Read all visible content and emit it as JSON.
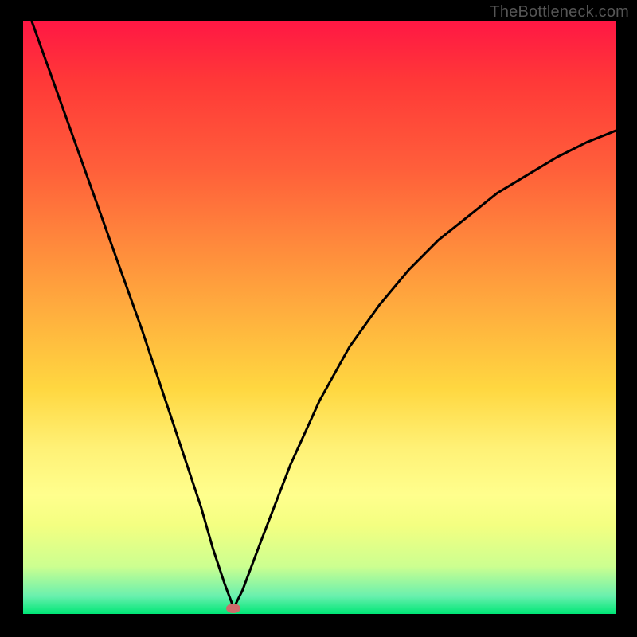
{
  "watermark": "TheBottleneck.com",
  "chart_data": {
    "type": "line",
    "title": "",
    "xlabel": "",
    "ylabel": "",
    "xlim": [
      0,
      100
    ],
    "ylim": [
      0,
      100
    ],
    "series": [
      {
        "name": "curve",
        "x": [
          0,
          5,
          10,
          15,
          20,
          25,
          28,
          30,
          32,
          34,
          35.5,
          37,
          40,
          45,
          50,
          55,
          60,
          65,
          70,
          75,
          80,
          85,
          90,
          95,
          100
        ],
        "y": [
          104,
          90,
          76,
          62,
          48,
          33,
          24,
          18,
          11,
          5,
          1,
          4,
          12,
          25,
          36,
          45,
          52,
          58,
          63,
          67,
          71,
          74,
          77,
          79.5,
          81.5
        ]
      }
    ],
    "marker": {
      "x": 35.5,
      "y": 1
    },
    "colors": {
      "top": "#ff1744",
      "bottom": "#00e676",
      "line": "#000000",
      "marker": "#cd6b6b"
    }
  }
}
